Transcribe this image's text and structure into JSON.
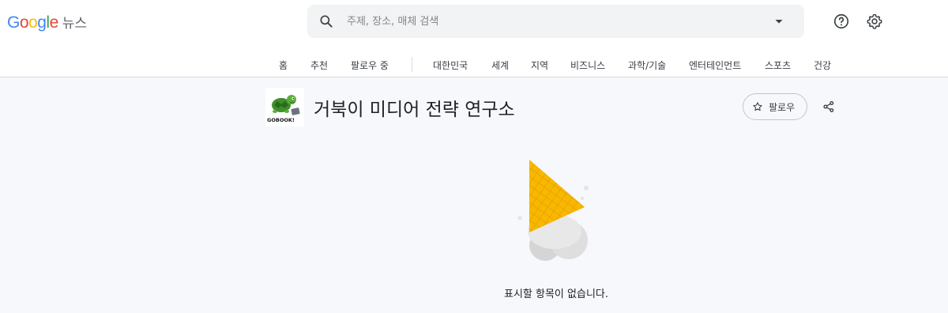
{
  "header": {
    "logo_brand": "Google",
    "logo_service": "뉴스",
    "search_placeholder": "주제, 장소, 매체 검색",
    "icons": [
      "search-icon",
      "dropdown-caret-icon",
      "help-icon",
      "settings-icon"
    ]
  },
  "nav": {
    "tabs": [
      {
        "label": "홈"
      },
      {
        "label": "추천"
      },
      {
        "label": "팔로우 중"
      },
      {
        "label": "대한민국"
      },
      {
        "label": "세계"
      },
      {
        "label": "지역"
      },
      {
        "label": "비즈니스"
      },
      {
        "label": "과학/기술"
      },
      {
        "label": "엔터테인먼트"
      },
      {
        "label": "스포츠"
      },
      {
        "label": "건강"
      }
    ]
  },
  "source": {
    "title": "거북이 미디어 전략 연구소",
    "logo_text": "GOBOOK!",
    "follow_label": "팔로우",
    "icons": [
      "star-outline-icon",
      "share-icon"
    ]
  },
  "empty_state": {
    "message": "표시할 항목이 없습니다.",
    "illustration": "dropped-ice-cream-cone"
  },
  "colors": {
    "google_blue": "#4285F4",
    "google_red": "#EA4335",
    "google_yellow": "#FBBC05",
    "google_green": "#34A853",
    "cone": "#F9B800",
    "page_bg": "#f6f8fc"
  }
}
